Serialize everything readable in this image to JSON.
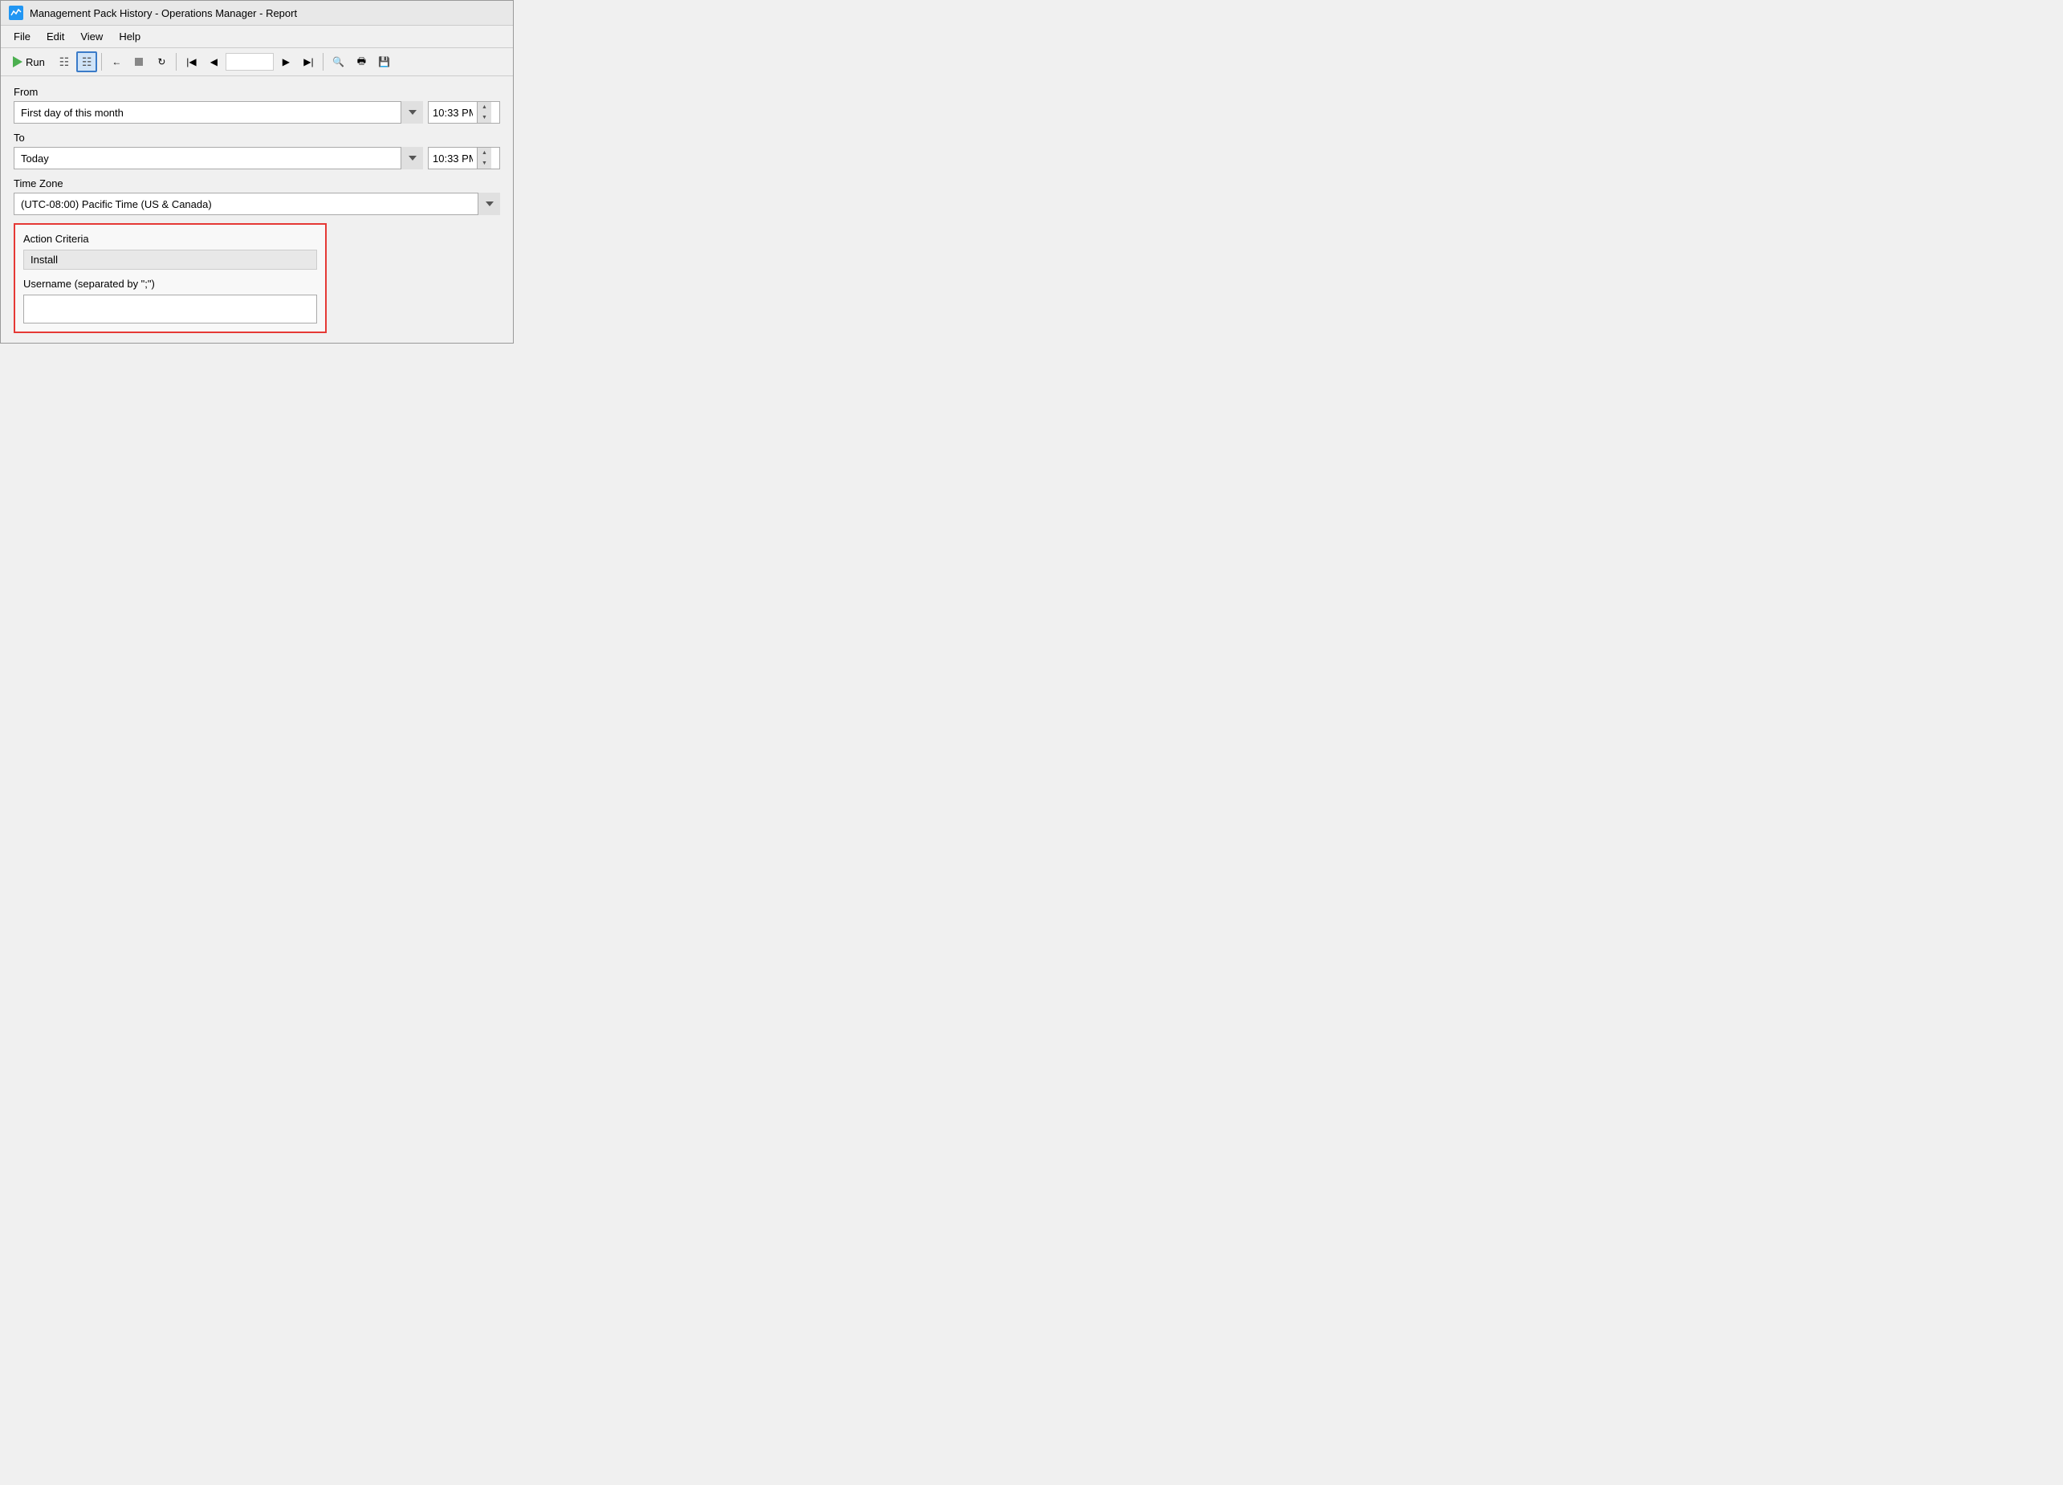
{
  "window": {
    "title": "Management Pack History - Operations Manager - Report",
    "icon_label": "wave-icon"
  },
  "menu": {
    "items": [
      "File",
      "Edit",
      "View",
      "Help"
    ]
  },
  "toolbar": {
    "run_label": "Run",
    "page_value": ""
  },
  "form": {
    "from_label": "From",
    "from_value": "First day of this month",
    "from_time": "10:33 PM",
    "to_label": "To",
    "to_value": "Today",
    "to_time": "10:33 PM",
    "timezone_label": "Time Zone",
    "timezone_value": "(UTC-08:00) Pacific Time (US & Canada)"
  },
  "red_box": {
    "action_criteria_label": "Action Criteria",
    "action_criteria_value": "Install",
    "username_label": "Username (separated by \";\")",
    "username_value": ""
  }
}
